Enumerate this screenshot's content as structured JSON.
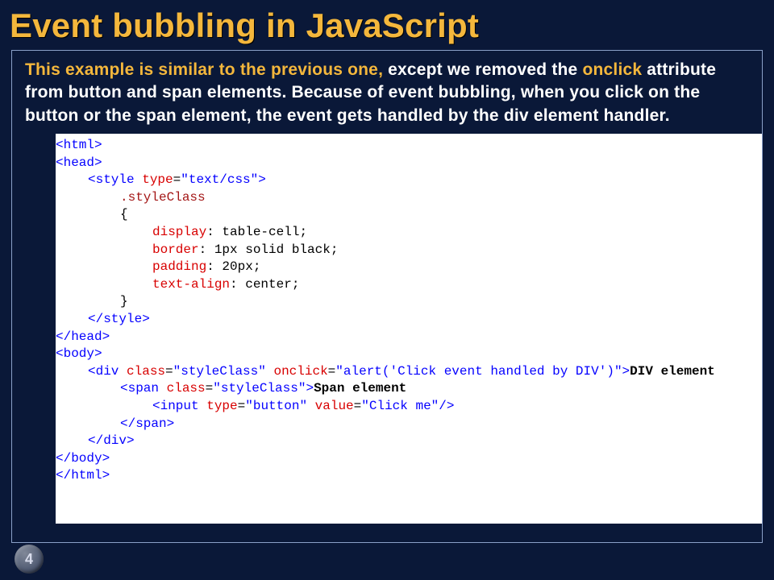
{
  "title": "Event bubbling in JavaScript",
  "desc": {
    "part1": "This example is similar to the previous one, ",
    "part2": "except we removed the ",
    "part3": "onclick",
    "part4": " attribute from button and span elements. Because of event bubbling, when you click on the button or the span element, the event gets handled by the div element handler."
  },
  "code": {
    "l0a": "<html>",
    "l0b": "<head>",
    "l1_open": "<style ",
    "l1_attr": "type",
    "l1_eq": "=",
    "l1_val": "\"text/css\"",
    "l1_close": ">",
    "l2": ".styleClass",
    "l3": "{",
    "l4a": "display",
    "l4b": ": table-cell;",
    "l5a": "border",
    "l5b": ": 1px solid black;",
    "l6a": "padding",
    "l6b": ": 20px;",
    "l7a": "text-align",
    "l7b": ": center;",
    "l8": "}",
    "l9": "</style>",
    "l10": "</head>",
    "l11": "<body>",
    "l12_open": "<div ",
    "l12_a1": "class",
    "l12_v1": "\"styleClass\"",
    "l12_a2": " onclick",
    "l12_v2": "\"alert('Click event handled by DIV')\"",
    "l12_end": ">",
    "l12_txt": "DIV element ",
    "l13_open": "<span ",
    "l13_a1": "class",
    "l13_v1": "\"styleClass\"",
    "l13_end": ">",
    "l13_txt": "Span element",
    "l14_open": "<input ",
    "l14_a1": "type",
    "l14_v1": "\"button\"",
    "l14_a2": " value",
    "l14_v2": "\"Click me\"",
    "l14_end": "/>",
    "l15": "</span>",
    "l16": "</div>",
    "l17": "</body>",
    "l18": "</html>"
  },
  "page": "4"
}
